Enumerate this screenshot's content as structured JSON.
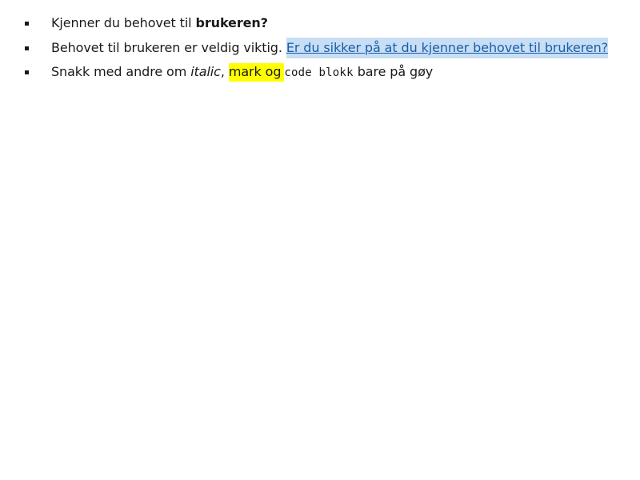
{
  "list": {
    "items": [
      {
        "text": "Kjenner du behovet til ",
        "bold": "brukeren?"
      },
      {
        "text": "Behovet til brukeren er veldig viktig. ",
        "link": "Er du sikker på at du kjenner behovet til brukeren?"
      },
      {
        "text_start": "Snakk med andre om ",
        "italic": "italic",
        "comma": ", ",
        "mark": "mark og",
        "code": "code blokk",
        "text_end": " bare på gøy"
      }
    ]
  },
  "colors": {
    "link": "#1a5fa8",
    "link_highlight": "#c8def5",
    "mark_highlight": "#ffff00",
    "text": "#1a1a1a"
  }
}
